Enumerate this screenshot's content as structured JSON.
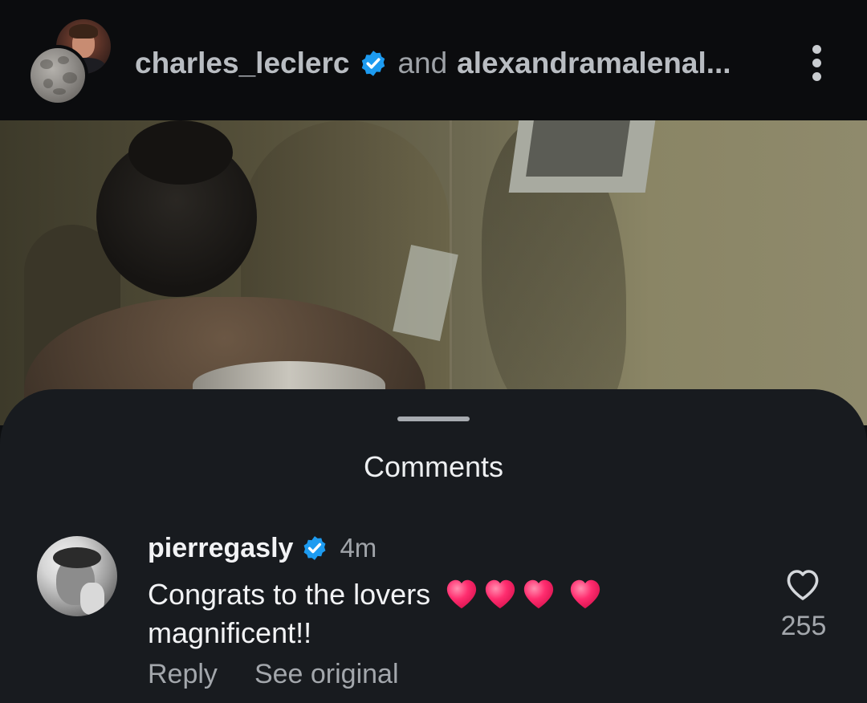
{
  "header": {
    "primary_user": "charles_leclerc",
    "connector": "and",
    "secondary_user": "alexandramalenal...",
    "more_icon": "more-vertical-icon",
    "verified_color": "#1d9bf0"
  },
  "comments_sheet": {
    "title": "Comments",
    "comment": {
      "username": "pierregasly",
      "timestamp": "4m",
      "text_line1": "Congrats to the lovers",
      "text_line2": "magnificent!!",
      "emoji": "heart",
      "emoji_count": 4,
      "emoji_color": "#ff2d6f",
      "like_icon": "heart-outline-icon",
      "like_count": "255",
      "reply_label": "Reply",
      "see_original_label": "See original"
    }
  }
}
